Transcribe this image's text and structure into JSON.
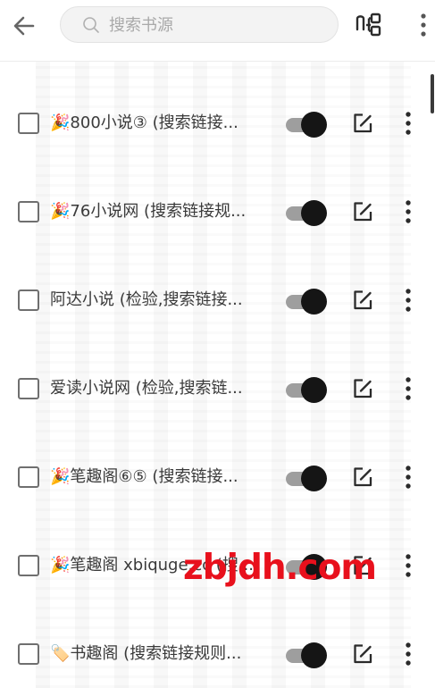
{
  "header": {
    "back_icon": "arrow-left-icon",
    "search_placeholder": "搜索书源",
    "search_value": "",
    "search_icon": "search-icon",
    "group_icon": "group-icon",
    "overflow_icon": "more-vertical-icon"
  },
  "sources": [
    {
      "prefix": "🎉",
      "name": "800小说③ (搜索链接...",
      "checked": false,
      "enabled": true
    },
    {
      "prefix": "🎉",
      "name": "76小说网 (搜索链接规...",
      "checked": false,
      "enabled": true
    },
    {
      "prefix": "",
      "name": "阿达小说 (检验,搜索链接...",
      "checked": false,
      "enabled": true
    },
    {
      "prefix": "",
      "name": "爱读小说网 (检验,搜索链...",
      "checked": false,
      "enabled": true
    },
    {
      "prefix": "🎉",
      "name": "笔趣阁⑥⑤ (搜索链接...",
      "checked": false,
      "enabled": true
    },
    {
      "prefix": "🎉",
      "name": "笔趣阁 xbiquge.cc (搜...",
      "checked": false,
      "enabled": true
    },
    {
      "prefix": "🏷️",
      "name": "书趣阁 (搜索链接规则...",
      "checked": false,
      "enabled": true
    }
  ],
  "watermark": "zbjdh.com",
  "colors": {
    "toggle_thumb": "#151515",
    "toggle_track": "#9e9e9e",
    "watermark": "#e8101c"
  }
}
